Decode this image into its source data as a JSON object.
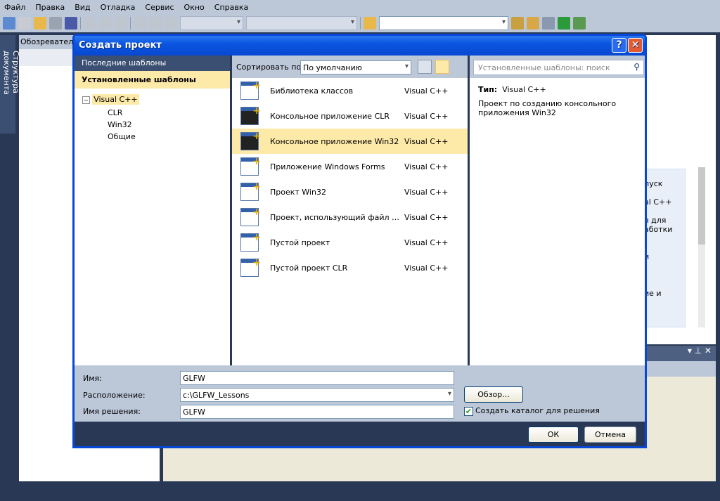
{
  "menu": [
    "Файл",
    "Правка",
    "Вид",
    "Отладка",
    "Сервис",
    "Окно",
    "Справка"
  ],
  "left_strip": {
    "label": "Структура документа"
  },
  "solution_explorer": {
    "title": "Обозреватель"
  },
  "start_page_fragments": [
    "пуск",
    "al C++",
    "я для",
    "аботки",
    "и",
    ".",
    "ие и"
  ],
  "dialog": {
    "title": "Создать проект",
    "help": "?",
    "close": "✕",
    "left": {
      "recent": "Последние шаблоны",
      "installed": "Установленные шаблоны",
      "tree": {
        "root": "Visual C++",
        "children": [
          "CLR",
          "Win32",
          "Общие"
        ]
      }
    },
    "sort": {
      "label": "Сортировать по:",
      "value": "По умолчанию"
    },
    "search": {
      "placeholder": "Установленные шаблоны: поиск"
    },
    "templates": [
      {
        "name": "Библиотека классов",
        "lang": "Visual C++",
        "icon": "class-library-icon"
      },
      {
        "name": "Консольное приложение CLR",
        "lang": "Visual C++",
        "icon": "console-icon"
      },
      {
        "name": "Консольное приложение Win32",
        "lang": "Visual C++",
        "icon": "console-icon",
        "selected": true
      },
      {
        "name": "Приложение Windows Forms",
        "lang": "Visual C++",
        "icon": "forms-icon"
      },
      {
        "name": "Проект Win32",
        "lang": "Visual C++",
        "icon": "win32-icon"
      },
      {
        "name": "Проект, использующий файл makefile",
        "lang": "Visual C++",
        "icon": "makefile-icon"
      },
      {
        "name": "Пустой проект",
        "lang": "Visual C++",
        "icon": "empty-project-icon"
      },
      {
        "name": "Пустой проект CLR",
        "lang": "Visual C++",
        "icon": "empty-project-icon"
      }
    ],
    "details": {
      "type_label": "Тип:",
      "type_value": "Visual C++",
      "description": "Проект по созданию консольного приложения Win32"
    },
    "form": {
      "name_label": "Имя:",
      "name_value": "GLFW",
      "location_label": "Расположение:",
      "location_value": "c:\\GLFW_Lessons",
      "solution_label": "Имя решения:",
      "solution_value": "GLFW",
      "browse": "Обзор...",
      "create_dir": "Создать каталог для решения",
      "create_dir_checked": true
    },
    "ok": "ОК",
    "cancel": "Отмена"
  }
}
